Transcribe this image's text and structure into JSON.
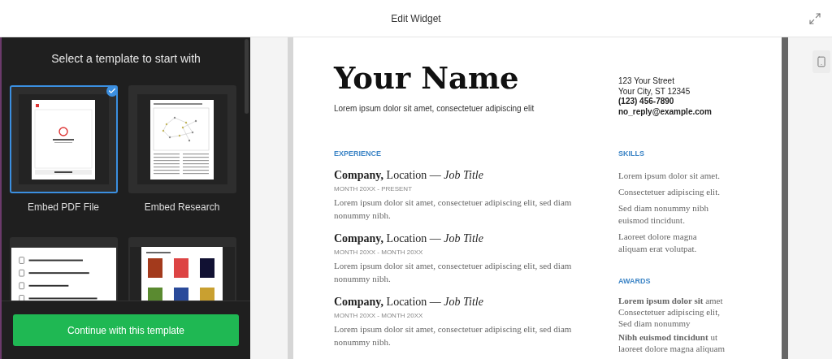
{
  "header": {
    "title": "Edit Widget"
  },
  "templates": {
    "heading": "Select a template to start with",
    "items": [
      {
        "kind": "pdf",
        "label": "Embed PDF File",
        "selected": true
      },
      {
        "kind": "research",
        "label": "Embed Research",
        "selected": false
      },
      {
        "kind": "list",
        "selected": false
      },
      {
        "kind": "magazine",
        "selected": false
      }
    ]
  },
  "continue_button": "Continue with this template",
  "resume": {
    "name": "Your Name",
    "tagline": "Lorem ipsum dolor sit amet, consectetuer adipiscing elit",
    "contact": [
      {
        "text": "123 Your Street",
        "bold": false
      },
      {
        "text": "Your City, ST 12345",
        "bold": false
      },
      {
        "text": "(123) 456-7890",
        "bold": true
      },
      {
        "text": "no_reply@example.com",
        "bold": true
      }
    ],
    "experience": {
      "heading": "EXPERIENCE",
      "jobs": [
        {
          "heading": "**Company,** Location — *Job Title*",
          "dates": "MONTH 20XX - PRESENT",
          "description": "Lorem ipsum dolor sit amet, consectetuer adipiscing elit, sed diam nonummy nibh."
        },
        {
          "heading": "**Company,** Location — *Job Title*",
          "dates": "MONTH 20XX - MONTH 20XX",
          "description": "Lorem ipsum dolor sit amet, consectetuer adipiscing elit, sed diam nonummy nibh."
        },
        {
          "heading": "**Company,** Location — *Job Title*",
          "dates": "MONTH 20XX - MONTH 20XX",
          "description": "Lorem ipsum dolor sit amet, consectetuer adipiscing elit, sed diam nonummy nibh."
        }
      ]
    },
    "skills": {
      "heading": "SKILLS",
      "items": [
        "Lorem ipsum dolor sit amet.",
        "Consectetuer adipiscing elit.",
        "Sed diam nonummy nibh euismod tincidunt.",
        "Laoreet dolore magna aliquam erat volutpat."
      ]
    },
    "awards": {
      "heading": "AWARDS",
      "items": [
        "**Lorem ipsum dolor sit** amet Consectetuer adipiscing elit, Sed diam nonummy",
        "**Nibh euismod tincidunt** ut laoreet dolore magna aliquam"
      ]
    }
  }
}
